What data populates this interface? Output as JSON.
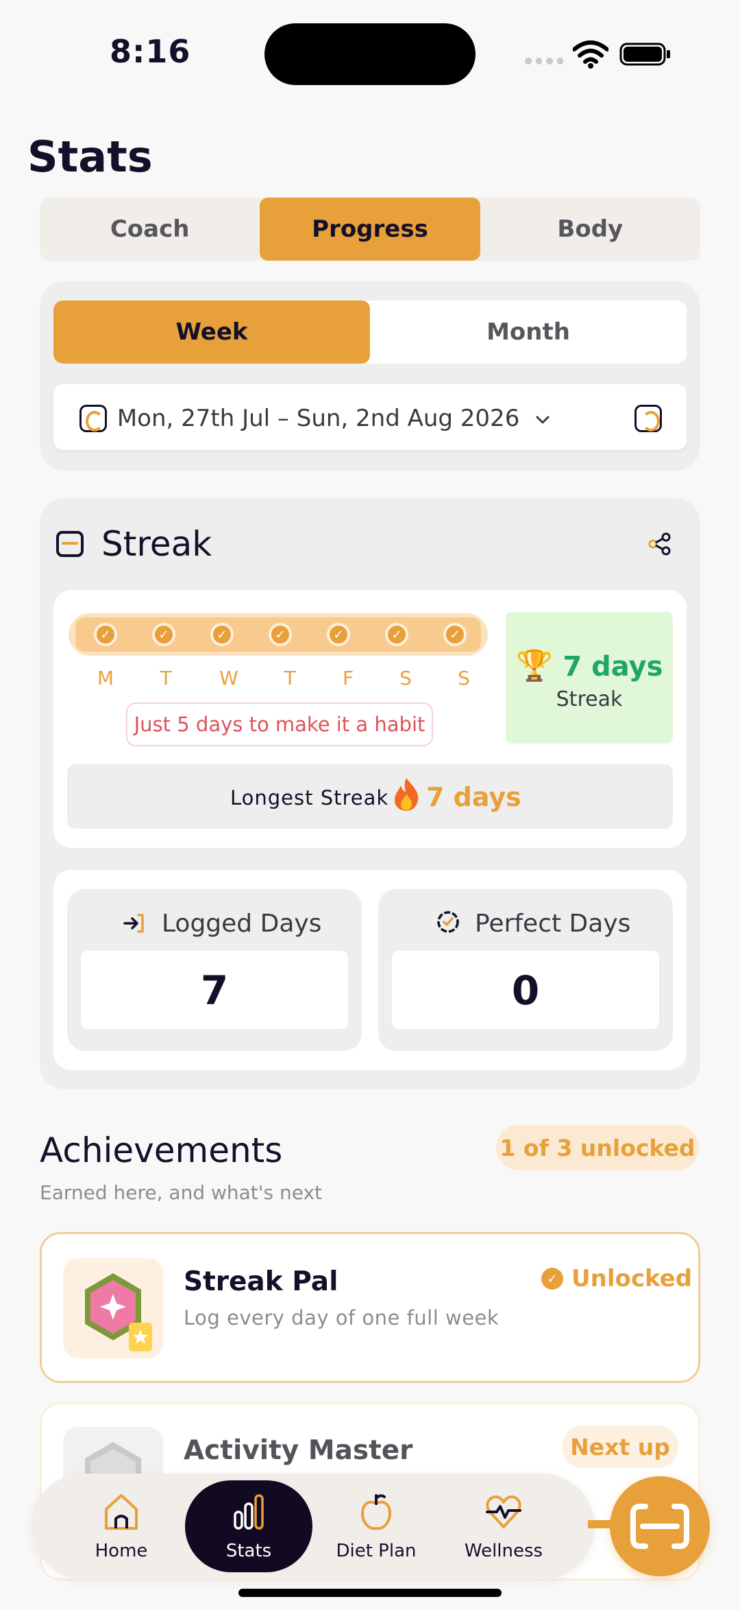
{
  "status_bar": {
    "time": "8:16"
  },
  "page": {
    "title": "Stats"
  },
  "top_tabs": [
    "Coach",
    "Progress",
    "Body"
  ],
  "period": {
    "options": [
      "Week",
      "Month"
    ],
    "range": "Mon, 27th Jul – Sun, 2nd Aug 2026"
  },
  "streak": {
    "title": "Streak",
    "days": [
      "M",
      "T",
      "W",
      "T",
      "F",
      "S",
      "S"
    ],
    "habit_note": "Just 5 days to make it a habit",
    "current_value": "7 days",
    "current_label": "Streak",
    "longest_label": "Longest Streak",
    "longest_value": "7 days"
  },
  "stats": {
    "logged_label": "Logged Days",
    "logged_value": "7",
    "perfect_label": "Perfect Days",
    "perfect_value": "0"
  },
  "achievements": {
    "title": "Achievements",
    "subtitle": "Earned here, and what's next",
    "progress": "1 of 3 unlocked",
    "items": [
      {
        "name": "Streak Pal",
        "description": "Log every day of one full week",
        "status": "Unlocked"
      },
      {
        "name": "Activity Master",
        "status": "Next up"
      }
    ]
  },
  "bottom_nav": [
    "Home",
    "Stats",
    "Diet Plan",
    "Wellness"
  ],
  "colors": {
    "accent": "#e8a03a",
    "success": "#1fa769",
    "warning_text": "#e05259",
    "nav_active": "#120a22"
  }
}
